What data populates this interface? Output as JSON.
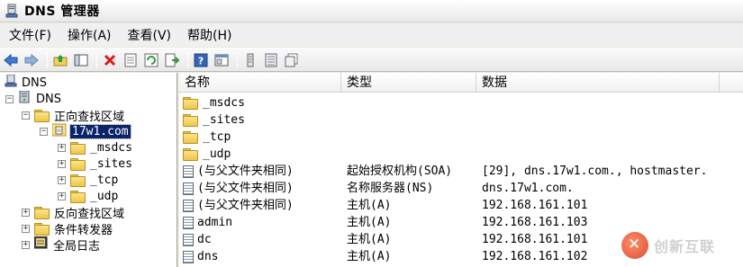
{
  "window": {
    "title": "DNS 管理器"
  },
  "menu": [
    "文件(F)",
    "操作(A)",
    "查看(V)",
    "帮助(H)"
  ],
  "toolbar": [
    {
      "icon": "back-icon"
    },
    {
      "icon": "forward-icon"
    },
    {
      "sep": true
    },
    {
      "icon": "up-folder-icon"
    },
    {
      "icon": "show-hide-tree-icon"
    },
    {
      "sep": true
    },
    {
      "icon": "delete-icon"
    },
    {
      "icon": "properties-icon"
    },
    {
      "icon": "refresh-icon"
    },
    {
      "icon": "export-list-icon"
    },
    {
      "sep": true
    },
    {
      "icon": "help-icon"
    },
    {
      "icon": "console-icon"
    },
    {
      "sep": true
    },
    {
      "icon": "record-icon"
    },
    {
      "icon": "list-icon"
    },
    {
      "icon": "copy-icon"
    }
  ],
  "tree": {
    "root": "DNS",
    "server": "DNS",
    "forward_zones": "正向查找区域",
    "zone": "17w1.com",
    "zone_children": [
      "_msdcs",
      "_sites",
      "_tcp",
      "_udp"
    ],
    "reverse_zones": "反向查找区域",
    "forwarders": "条件转发器",
    "global_log": "全局日志"
  },
  "list": {
    "columns": [
      "名称",
      "类型",
      "数据"
    ],
    "rows": [
      {
        "name": "_msdcs",
        "type": "",
        "data": "",
        "icon": "folder-icon"
      },
      {
        "name": "_sites",
        "type": "",
        "data": "",
        "icon": "folder-icon"
      },
      {
        "name": "_tcp",
        "type": "",
        "data": "",
        "icon": "folder-icon"
      },
      {
        "name": "_udp",
        "type": "",
        "data": "",
        "icon": "folder-icon"
      },
      {
        "name": "(与父文件夹相同)",
        "type": "起始授权机构(SOA)",
        "data": "[29], dns.17w1.com., hostmaster.",
        "icon": "record-icon"
      },
      {
        "name": "(与父文件夹相同)",
        "type": "名称服务器(NS)",
        "data": "dns.17w1.com.",
        "icon": "record-icon"
      },
      {
        "name": "(与父文件夹相同)",
        "type": "主机(A)",
        "data": "192.168.161.101",
        "icon": "record-icon"
      },
      {
        "name": "admin",
        "type": "主机(A)",
        "data": "192.168.161.103",
        "icon": "record-icon"
      },
      {
        "name": "dc",
        "type": "主机(A)",
        "data": "192.168.161.101",
        "icon": "record-icon"
      },
      {
        "name": "dns",
        "type": "主机(A)",
        "data": "192.168.161.102",
        "icon": "record-icon"
      }
    ]
  },
  "watermark": {
    "text": "创新互联"
  }
}
